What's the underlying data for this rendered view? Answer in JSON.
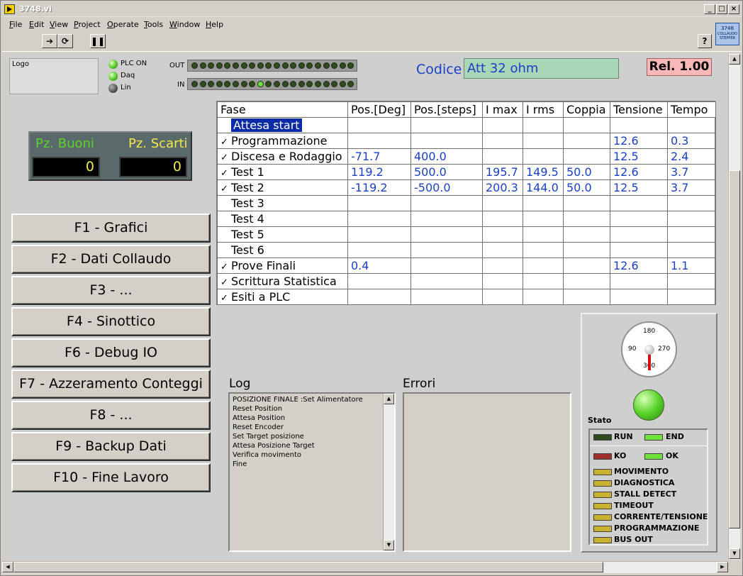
{
  "window": {
    "title": "3748.vi",
    "min": "_",
    "max": "□",
    "close": "×"
  },
  "menu": [
    "File",
    "Edit",
    "View",
    "Project",
    "Operate",
    "Tools",
    "Window",
    "Help"
  ],
  "toolbar": {
    "help": "?"
  },
  "brand": {
    "line1": "3748",
    "line2": "COLLAUDO",
    "line3": "STEPPER"
  },
  "logo": {
    "label": "Logo"
  },
  "status_leds": [
    {
      "label": "PLC ON",
      "state": "on"
    },
    {
      "label": "Daq",
      "state": "on"
    },
    {
      "label": "Lin",
      "state": "off"
    }
  ],
  "io": {
    "out_label": "OUT",
    "in_label": "IN",
    "out_count": 20,
    "in_count": 20,
    "in_active": [
      8
    ]
  },
  "codice": {
    "label": "Codice",
    "value": "Att 32 ohm"
  },
  "release": "Rel. 1.00",
  "counters": {
    "good_label": "Pz. Buoni",
    "good_value": "0",
    "reject_label": "Pz. Scarti",
    "reject_value": "0"
  },
  "fkeys": [
    "F1 - Grafici",
    "F2 - Dati Collaudo",
    "F3 - ...",
    "F4 - Sinottico",
    "F6 - Debug IO",
    "F7 - Azzeramento Conteggi",
    "F8 - ...",
    "F9 - Backup Dati",
    "F10 - Fine Lavoro"
  ],
  "table": {
    "headers": [
      "Fase",
      "Pos.[Deg]",
      "Pos.[steps]",
      "I max",
      "I rms",
      "Coppia",
      "Tensione",
      "Tempo"
    ],
    "rows": [
      {
        "check": "",
        "phase": "Attesa start",
        "selected": true,
        "cells": [
          "",
          "",
          "",
          "",
          "",
          "",
          ""
        ]
      },
      {
        "check": "✓",
        "phase": "Programmazione",
        "cells": [
          "",
          "",
          "",
          "",
          "",
          "12.6",
          "0.3"
        ]
      },
      {
        "check": "✓",
        "phase": "Discesa e Rodaggio",
        "cells": [
          "-71.7",
          "400.0",
          "",
          "",
          "",
          "12.5",
          "2.4"
        ]
      },
      {
        "check": "✓",
        "phase": "Test 1",
        "cells": [
          "119.2",
          "500.0",
          "195.7",
          "149.5",
          "50.0",
          "12.6",
          "3.7"
        ]
      },
      {
        "check": "✓",
        "phase": "Test 2",
        "cells": [
          "-119.2",
          "-500.0",
          "200.3",
          "144.0",
          "50.0",
          "12.5",
          "3.7"
        ]
      },
      {
        "check": "",
        "phase": "Test 3",
        "cells": [
          "",
          "",
          "",
          "",
          "",
          "",
          ""
        ]
      },
      {
        "check": "",
        "phase": "Test 4",
        "cells": [
          "",
          "",
          "",
          "",
          "",
          "",
          ""
        ]
      },
      {
        "check": "",
        "phase": "Test 5",
        "cells": [
          "",
          "",
          "",
          "",
          "",
          "",
          ""
        ]
      },
      {
        "check": "",
        "phase": "Test 6",
        "cells": [
          "",
          "",
          "",
          "",
          "",
          "",
          ""
        ]
      },
      {
        "check": "✓",
        "phase": "Prove Finali",
        "cells": [
          "0.4",
          "",
          "",
          "",
          "",
          "12.6",
          "1.1"
        ]
      },
      {
        "check": "✓",
        "phase": "Scrittura Statistica",
        "cells": [
          "",
          "",
          "",
          "",
          "",
          "",
          ""
        ]
      },
      {
        "check": "✓",
        "phase": "Esiti a PLC",
        "cells": [
          "",
          "",
          "",
          "",
          "",
          "",
          ""
        ]
      }
    ]
  },
  "log": {
    "label": "Log",
    "lines": [
      "POSIZIONE FINALE :Set Alimentatore",
      "Reset Position",
      "Attesa Position",
      "Reset Encoder",
      "Set Target posizione",
      "Attesa Posizione Target",
      "Verifica movimento",
      "Fine"
    ]
  },
  "errors": {
    "label": "Errori"
  },
  "dial": {
    "t180": "180",
    "t90": "90",
    "t270": "270",
    "t360": "360"
  },
  "stato": {
    "label": "Stato",
    "run": "RUN",
    "end": "END",
    "ko": "KO",
    "ok": "OK",
    "flags": [
      "MOVIMENTO",
      "DIAGNOSTICA",
      "STALL DETECT",
      "TIMEOUT",
      "CORRENTE/TENSIONE",
      "PROGRAMMAZIONE",
      "BUS OUT"
    ],
    "colors": {
      "led_on": "#6fe03c",
      "led_off_dark": "#2f4a1f",
      "ko_red": "#a03030",
      "flag_yellow": "#c8b030"
    }
  }
}
